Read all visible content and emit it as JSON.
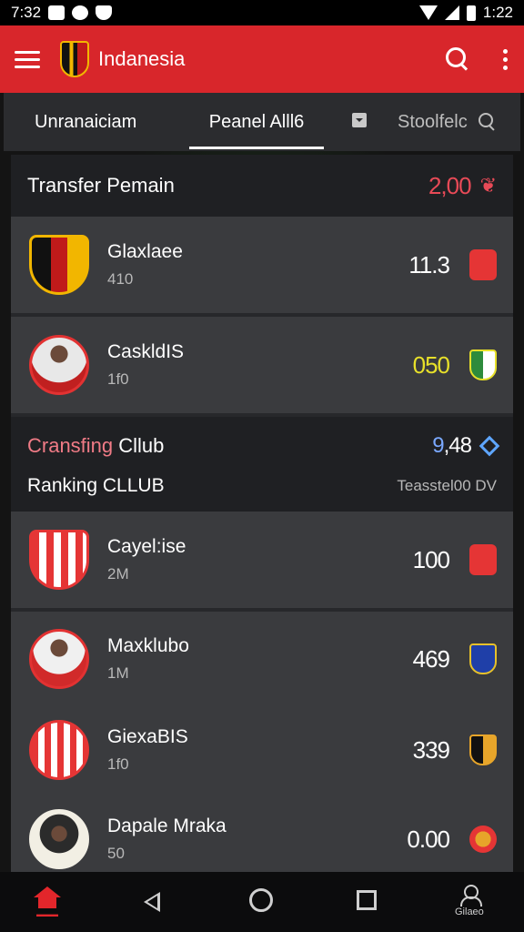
{
  "status_bar": {
    "time_left": "7:32",
    "time_right": "1:22"
  },
  "app_bar": {
    "title": "Indanesia"
  },
  "tabs": [
    {
      "label": "Unranaiciam"
    },
    {
      "label": "Peanel Alll6",
      "active": true
    },
    {
      "label": "Stoolfelc"
    }
  ],
  "transfer": {
    "title": "Transfer Pemain",
    "value": "2,00"
  },
  "rows_top": [
    {
      "name": "Glaxlaee",
      "sub": "410",
      "value": "11.3",
      "value_color": "#ffffff",
      "badge_colors": [
        "#e53535",
        "#c61f1f"
      ]
    },
    {
      "name": "CaskldIS",
      "sub": "1f0",
      "value": "050",
      "value_color": "#e7e02a",
      "badge_colors": [
        "#2e8b3c",
        "#e7e02a"
      ]
    }
  ],
  "mid": {
    "title_colored": "Cransfing",
    "title_white": " Cllub",
    "value_colored": "9",
    "value_white": ",48",
    "subtitle": "Ranking CLLUB",
    "note": "Teasstel00 DV"
  },
  "rows_bottom": [
    {
      "name": "Cayel:ise",
      "sub": "2M",
      "value": "100",
      "badge_colors": [
        "#e53535",
        "#c61f1f"
      ]
    },
    {
      "name": "Maxklubo",
      "sub": "1M",
      "value": "469",
      "badge_colors": [
        "#1f3fa8",
        "#e7c12a"
      ]
    },
    {
      "name": "GiexaBIS",
      "sub": "1f0",
      "value": "339",
      "badge_colors": [
        "#111111",
        "#e7a52a"
      ]
    },
    {
      "name": "Dapale Mraka",
      "sub": "50",
      "value": "0.00",
      "badge_colors": [
        "#e53535",
        "#e7a52a"
      ]
    }
  ],
  "bottom_nav": {
    "profile_label": "Gilaeo"
  },
  "colors": {
    "accent": "#d8262b",
    "highlight_red": "#e84a57",
    "highlight_yellow": "#e7e02a",
    "highlight_blue": "#7aa8ff"
  }
}
